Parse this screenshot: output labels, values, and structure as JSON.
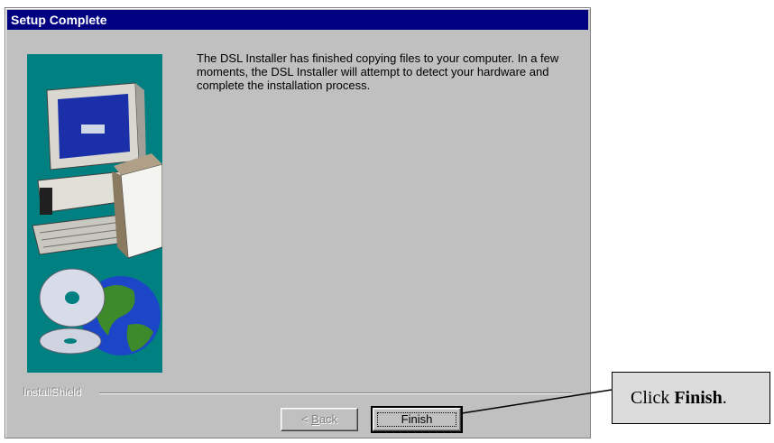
{
  "window": {
    "title": "Setup Complete"
  },
  "message": "The DSL Installer has finished copying files to your computer.  In a few moments, the DSL Installer will attempt to detect your hardware and complete the installation process.",
  "footer": {
    "brand": "InstallShield"
  },
  "buttons": {
    "back_accel": "B",
    "back_rest": "ack",
    "back_prefix": "< ",
    "finish": "Finish"
  },
  "callout": {
    "prefix": "Click ",
    "bold": "Finish",
    "suffix": "."
  },
  "colors": {
    "titlebar": "#000080",
    "dialog": "#c0c0c0",
    "banner": "#008080"
  }
}
